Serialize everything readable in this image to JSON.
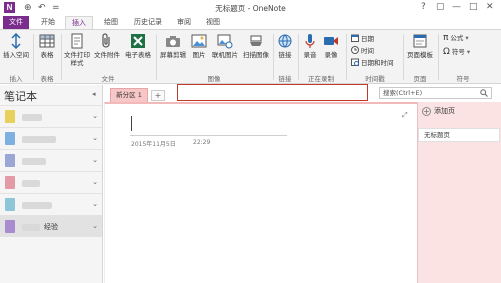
{
  "titlebar": {
    "logo": "N",
    "title": "无标题页 - OneNote",
    "back_symbol": "⊕",
    "undo_symbol": "↶",
    "qa_more": "=",
    "help": "?",
    "ribbon_display": "▢",
    "minimize": "—",
    "maximize": "□",
    "close": "✕"
  },
  "tabs": [
    {
      "label": "文件"
    },
    {
      "label": "开始"
    },
    {
      "label": "插入"
    },
    {
      "label": "绘图"
    },
    {
      "label": "历史记录"
    },
    {
      "label": "审阅"
    },
    {
      "label": "视图"
    }
  ],
  "ribbon": {
    "insert_space": "插入空间",
    "table": "表格",
    "file_printout": "文件打印样式",
    "file_attachment": "文件附件",
    "spreadsheet": "电子表格",
    "screen_clipping": "屏幕剪辑",
    "picture": "图片",
    "online_picture": "联机图片",
    "scan_image": "扫描图像",
    "link": "链接",
    "record_audio": "录音",
    "record_video": "录像",
    "date": "日期",
    "time": "时间",
    "date_time": "日期和时间",
    "page_template": "页面模板",
    "equation": "公式",
    "symbol": "符号",
    "group_labels": {
      "insert": "插入",
      "tables": "表格",
      "files": "文件",
      "images": "图像",
      "links": "链接",
      "recording": "正在录制",
      "timestamp": "时间戳",
      "pages": "页面",
      "symbols": "符号"
    }
  },
  "notebook_pane": {
    "title": "笔记本",
    "collapse": "◂",
    "notebooks": [
      {
        "color": "#e8d15a",
        "name": ""
      },
      {
        "color": "#7db0e0",
        "name": ""
      },
      {
        "color": "#9aa6d6",
        "name": ""
      },
      {
        "color": "#e39aa6",
        "name": ""
      },
      {
        "color": "#8ec6d8",
        "name": ""
      },
      {
        "color": "#a88ccf",
        "name": "经验"
      }
    ],
    "arrow": "⌄"
  },
  "section_bar": {
    "pin": "⊻",
    "section_tab": "新分区 1",
    "add_section": "+",
    "search_placeholder": "搜索(Ctrl+E)"
  },
  "page": {
    "date": "2015年11月5日",
    "time": "22:29",
    "expand": "⤢"
  },
  "pages_pane": {
    "add_page": "添加页",
    "add_page_symbol": "+",
    "page_item": "无标题页"
  }
}
